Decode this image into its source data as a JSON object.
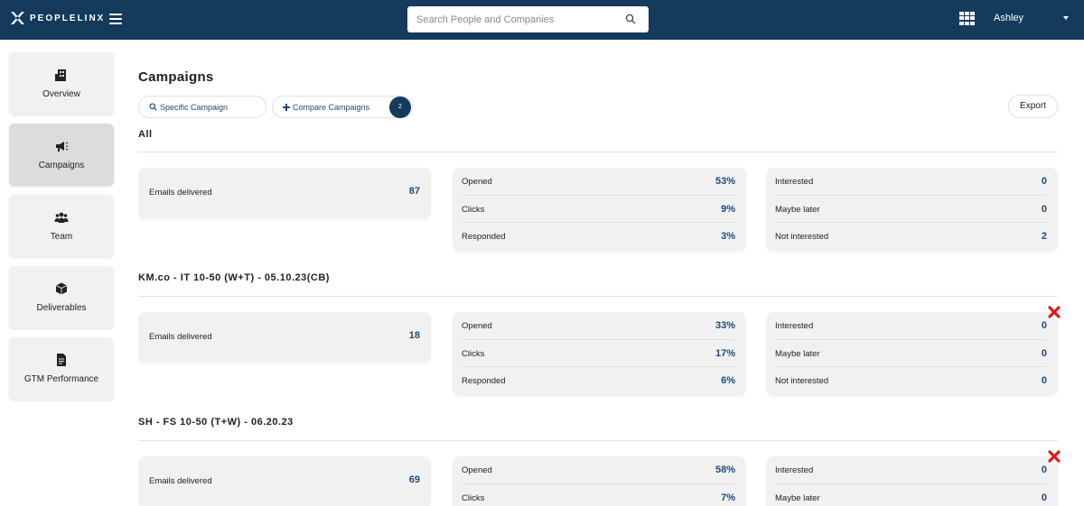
{
  "brand": {
    "name": "PEOPLELINX"
  },
  "search": {
    "placeholder": "Search People and Companies"
  },
  "user": {
    "name": "Ashley"
  },
  "sidebar": {
    "items": [
      {
        "label": "Overview",
        "icon": "building-icon"
      },
      {
        "label": "Campaigns",
        "icon": "megaphone-icon",
        "active": true
      },
      {
        "label": "Team",
        "icon": "team-icon"
      },
      {
        "label": "Deliverables",
        "icon": "box-icon"
      },
      {
        "label": "GTM Performance",
        "icon": "document-icon"
      }
    ]
  },
  "page": {
    "title": "Campaigns",
    "specific_campaign_label": "Specific Campaign",
    "compare_campaigns_label": "Compare Campaigns",
    "compare_count": "2",
    "export_label": "Export"
  },
  "sections": [
    {
      "title": "All",
      "emails_delivered_label": "Emails delivered",
      "emails_delivered": "87",
      "engagement": [
        {
          "label": "Opened",
          "value": "53%"
        },
        {
          "label": "Clicks",
          "value": "9%"
        },
        {
          "label": "Responded",
          "value": "3%"
        }
      ],
      "responses": [
        {
          "label": "Interested",
          "value": "0"
        },
        {
          "label": "Maybe later",
          "value": "0"
        },
        {
          "label": "Not interested",
          "value": "2"
        }
      ]
    },
    {
      "title": "KM.co - IT 10-50 (W+T) - 05.10.23(CB)",
      "emails_delivered_label": "Emails delivered",
      "emails_delivered": "18",
      "engagement": [
        {
          "label": "Opened",
          "value": "33%"
        },
        {
          "label": "Clicks",
          "value": "17%"
        },
        {
          "label": "Responded",
          "value": "6%"
        }
      ],
      "responses": [
        {
          "label": "Interested",
          "value": "0"
        },
        {
          "label": "Maybe later",
          "value": "0"
        },
        {
          "label": "Not interested",
          "value": "0"
        }
      ]
    },
    {
      "title": "SH - FS 10-50 (T+W) - 06.20.23",
      "emails_delivered_label": "Emails delivered",
      "emails_delivered": "69",
      "engagement": [
        {
          "label": "Opened",
          "value": "58%"
        },
        {
          "label": "Clicks",
          "value": "7%"
        }
      ],
      "responses": [
        {
          "label": "Interested",
          "value": "0"
        },
        {
          "label": "Maybe later",
          "value": "0"
        }
      ]
    }
  ],
  "colors": {
    "topbar": "#143a5c",
    "accent_value": "#1d4a7a",
    "remove": "#e0191e",
    "card": "#f1f1f1"
  }
}
